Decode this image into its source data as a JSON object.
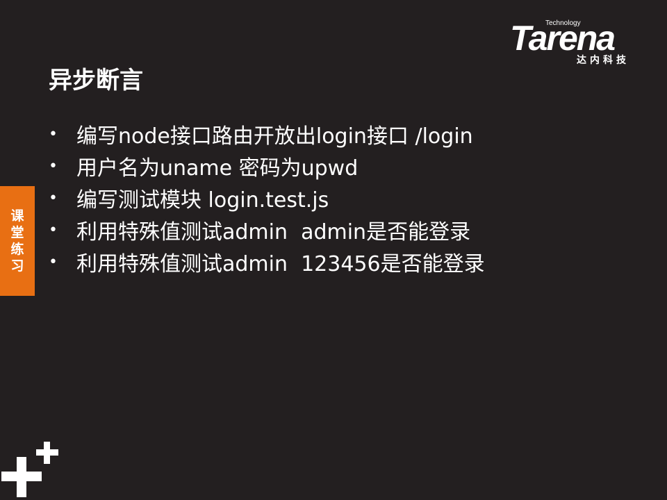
{
  "logo": {
    "small": "Technology",
    "word": "Tarena",
    "cn": "达内科技"
  },
  "title": "异步断言",
  "bullets": [
    "编写node接口路由开放出login接口 /login",
    "用户名为uname 密码为upwd",
    "编写测试模块 login.test.js",
    "利用特殊值测试admin  admin是否能登录",
    "利用特殊值测试admin  123456是否能登录"
  ],
  "bullet_symbol": "•",
  "side_tab": {
    "chars": [
      "课",
      "堂",
      "练",
      "习"
    ],
    "color": "#e86f13"
  },
  "colors": {
    "background": "#231f20",
    "text": "#ffffff",
    "accent": "#e86f13"
  }
}
